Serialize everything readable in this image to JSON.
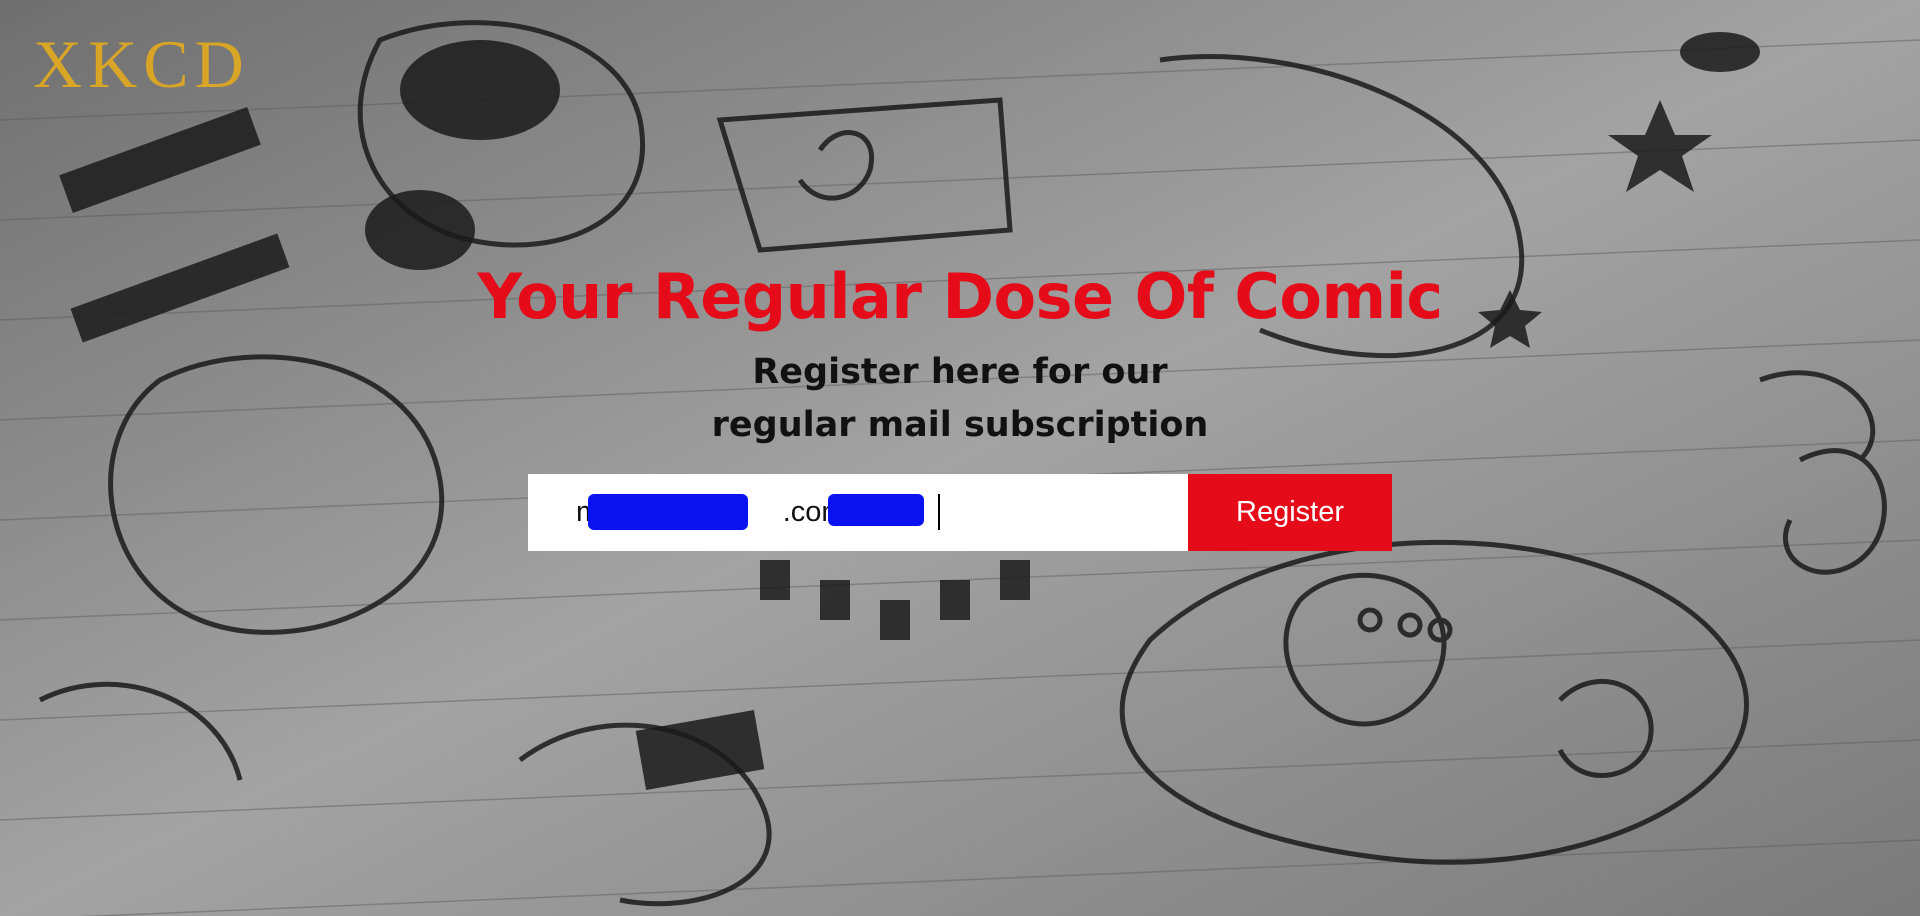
{
  "brand": {
    "name": "XKCD",
    "color": "#d8a526"
  },
  "hero": {
    "title": "Your Regular Dose Of Comic",
    "subtitle": "Register here for our regular mail subscription",
    "title_color": "#e50b19"
  },
  "form": {
    "email_value": "m        th@g      .com",
    "register_label": "Register",
    "button_color": "#e50b19"
  },
  "background": {
    "description_icon": "doodle-sketch-background"
  }
}
